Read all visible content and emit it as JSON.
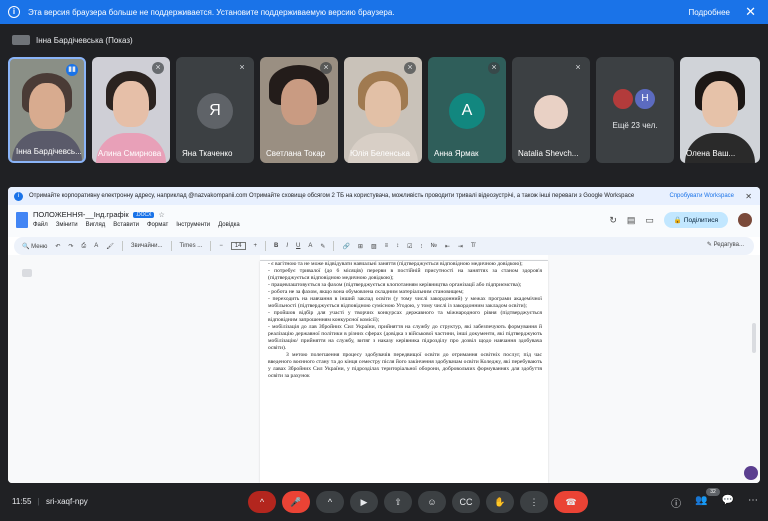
{
  "banner": {
    "message": "Эта версия браузера больше не поддерживается. Установите поддерживаемую версию браузера.",
    "more_label": "Подробнее"
  },
  "presenter": {
    "label": "Інна Бардічевська (Показ)"
  },
  "tiles": [
    {
      "name": "Інна Бардічевсь..."
    },
    {
      "name": "Алина Смирнова"
    },
    {
      "name": "Яна Ткаченко",
      "initial": "Я"
    },
    {
      "name": "Светлана Токар"
    },
    {
      "name": "Юлія Беленська"
    },
    {
      "name": "Анна Ярмак",
      "initial": "А"
    },
    {
      "name": "Natalia Shevch..."
    },
    {
      "more_label": "Ещё 23 чел.",
      "initial": "Н"
    },
    {
      "name": "Олена Ваш..."
    }
  ],
  "promo": {
    "text": "Отримайте корпоративну електронну адресу, наприклад @nazvakompanii.com   Отримайте сховище обсягом 2 ТБ на користувача, можливість проводити тривалі відеозустрічі, а також інші переваги з Google Workspace",
    "button": "Спробувати Workspace"
  },
  "doc": {
    "title": "ПОЛОЖЕННЯ-__Інд.графік",
    "badge": ".DOCX",
    "menus": [
      "Файл",
      "Змінити",
      "Вигляд",
      "Вставити",
      "Формат",
      "Інструменти",
      "Довідка"
    ],
    "share_label": "Поділитися",
    "toolbar": {
      "menu": "Меню",
      "style": "Звичайни...",
      "font": "Times ...",
      "size": "14",
      "edit_mode": "Редагува..."
    },
    "body": [
      "-          є вагітною та не може відвідувати навчальні заняття (підтверджується відповідною медичною довідкою);",
      "-          потребує тривалої (до 6 місяців) перерви в постійній присутності на заняттях за станом здоров'я (підтверджується відповідною медичною довідкою);",
      "-          працевлаштовується за фахом (підтверджується клопотанням керівництва організації або підприємства);",
      "-          робота не за фахом, якщо вона обумовлена складним матеріальним становищем;",
      "-          переходить на навчання в інший заклад освіти (у тому числі закордонний) у межах програми академічної мобільності (підтверджується відповідною сумісною Угодою, у тому числі із закордонним закладом освіти);",
      "-          пройшов відбір для участі у творчих конкурсах державного та міжнародного рівня (підтверджується відповідним запрошенням конкурсної комісії);",
      "-          мобілізація до лав Збройних Сил України, прийняття на службу до структур, які забезпечують формування й реалізацію державної політики в різних сферах (довідка з військової частини, інші документи, які підтверджують мобілізацію/ прийняття на службу, витяг з наказу керівника підрозділу про дозвіл щодо навчання здобувача освіти).",
      "З метою полегшення процесу здобувачів передвищої освіти до отримання освітніх послуг, під час введеного воєнного стану та до кінця семестру після його закінчення здобувачам освіти Коледжу, які перебувають у лавах Збройних Сил України, у підрозділах територіальної оборони, добровольчих формуваннях для здобуття освіти за рахунок"
    ]
  },
  "bottom": {
    "time": "11:55",
    "meeting_code": "sri-xaqf-npy",
    "participants_count": "32"
  }
}
